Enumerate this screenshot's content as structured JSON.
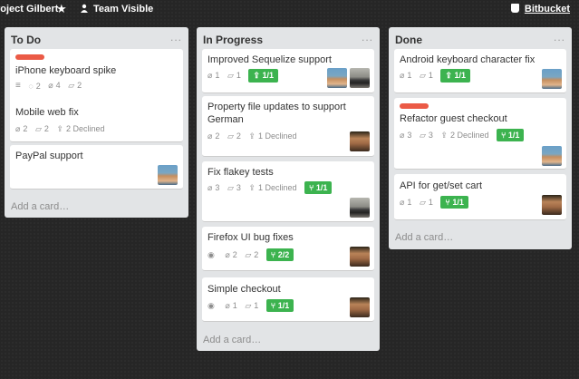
{
  "topbar": {
    "board_name": "roject Gilbert",
    "star_icon": "★",
    "visibility": "Team Visible",
    "integration": "Bitbucket"
  },
  "lists": [
    {
      "title": "To Do",
      "menu": "...",
      "add_card": "Add a card…",
      "cards": [
        {
          "title": "iPhone keyboard spike",
          "label_color": "#eb5a46",
          "badges": {
            "description": "≡",
            "comments": "2",
            "attachments": "4",
            "checks": "2"
          }
        },
        {
          "title": "Mobile web fix",
          "badges": {
            "attachments": "2",
            "checks": "2",
            "pr_text": "2 Declined"
          }
        },
        {
          "title": "PayPal support"
        }
      ]
    },
    {
      "title": "In Progress",
      "menu": "...",
      "add_card": "Add a card…",
      "cards": [
        {
          "title": "Improved Sequelize support",
          "badges": {
            "attachments": "1",
            "checks": "1",
            "green": "1/1"
          }
        },
        {
          "title": "Property file updates to support German",
          "badges": {
            "attachments": "2",
            "checks": "2",
            "pr_text": "1 Declined"
          }
        },
        {
          "title": "Fix flakey tests",
          "badges": {
            "attachments": "3",
            "checks": "3",
            "pr_text": "1 Declined",
            "green": "1/1"
          }
        },
        {
          "title": "Firefox UI bug fixes",
          "badges": {
            "attachments": "2",
            "checks": "2",
            "green": "2/2"
          }
        },
        {
          "title": "Simple checkout",
          "badges": {
            "attachments": "1",
            "checks": "1",
            "green": "1/1"
          }
        }
      ]
    },
    {
      "title": "Done",
      "menu": "...",
      "add_card": "Add a card…",
      "cards": [
        {
          "title": "Android keyboard character fix",
          "badges": {
            "attachments": "1",
            "checks": "1",
            "green": "1/1"
          }
        },
        {
          "title": "Refactor guest checkout",
          "label_color": "#eb5a46",
          "badges": {
            "attachments": "3",
            "checks": "3",
            "pr_text": "2 Declined",
            "green": "1/1"
          }
        },
        {
          "title": "API for get/set cart",
          "badges": {
            "attachments": "1",
            "checks": "1",
            "green": "1/1"
          }
        }
      ]
    }
  ],
  "icons": {
    "attachment": "paperclip-icon",
    "checklist": "bucket-icon",
    "pull_request": "upload-icon",
    "branch": "branch-icon",
    "watch": "eye-icon",
    "comment": "comment-icon",
    "description": "description-icon"
  },
  "colors": {
    "background": "#262626",
    "list": "#e2e4e6",
    "label_red": "#eb5a46",
    "badge_green": "#3cb34f"
  }
}
